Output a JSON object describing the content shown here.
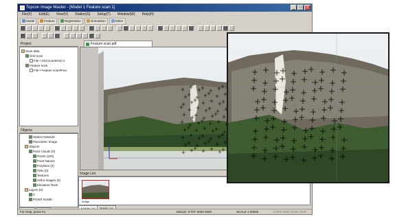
{
  "window": {
    "title": "Topcon Image Master - [Model 1 Feature scan 1]"
  },
  "menu": [
    "File(F)",
    "Edit(E)",
    "View(V)",
    "Station(S)",
    "Setup(T)",
    "Window(W)",
    "Help(H)"
  ],
  "workspaces": [
    {
      "label": "Model",
      "color": "#6a8fc9"
    },
    {
      "label": "Feature",
      "color": "#d08a2a"
    },
    {
      "label": "Registration",
      "color": "#4a9a4a"
    },
    {
      "label": "Orientation",
      "color": "#c9a040"
    },
    {
      "label": "Editor",
      "color": "#7aa3d8"
    }
  ],
  "project_panel": {
    "header": "Project",
    "tree": [
      {
        "label": "Scan data",
        "indent": 0,
        "color": "#e0c060"
      },
      {
        "label": "Grid scan",
        "indent": 1,
        "color": "#5a9a5a"
      },
      {
        "label": "File • Grid scan#Grid s",
        "indent": 2,
        "color": "#ffffff"
      },
      {
        "label": "Feature scan",
        "indent": 1,
        "color": "#5a9a5a"
      },
      {
        "label": "File • Feature scan#Fea",
        "indent": 2,
        "color": "#ffffff"
      }
    ]
  },
  "objects_panel": {
    "header": "Objects",
    "tree": [
      {
        "label": "Station Network",
        "indent": 2,
        "color": "#5a9a5a"
      },
      {
        "label": "Panoramic Image",
        "indent": 2,
        "color": "#5a9a5a"
      },
      {
        "label": "Objects",
        "indent": 1,
        "color": "#e0c060"
      },
      {
        "label": "Point Clouds (0)",
        "indent": 2,
        "color": "#4a9a4a"
      },
      {
        "label": "Points (100)",
        "indent": 3,
        "color": "#4a9a4a"
      },
      {
        "label": "Point Names",
        "indent": 3,
        "color": "#4a9a4a"
      },
      {
        "label": "Polylines (0)",
        "indent": 3,
        "color": "#4a9a4a"
      },
      {
        "label": "TINs (0)",
        "indent": 3,
        "color": "#4a9a4a"
      },
      {
        "label": "Textures",
        "indent": 3,
        "color": "#4a9a4a"
      },
      {
        "label": "Ortho-images (0)",
        "indent": 3,
        "color": "#4a9a4a"
      },
      {
        "label": "Elevation Texts",
        "indent": 3,
        "color": "#4a9a4a"
      },
      {
        "label": "Layers (0)",
        "indent": 1,
        "color": "#e0c060"
      },
      {
        "label": "0",
        "indent": 2,
        "color": "#4a9a4a"
      },
      {
        "label": "POINT NAME",
        "indent": 2,
        "color": "#4a9a4a"
      }
    ]
  },
  "panel_tabs": [
    "Objects",
    "Details"
  ],
  "doc_tab": "Feature scan.pdf",
  "image_list": {
    "header": "Image List",
    "tabs": [
      "Image List",
      "Detail List"
    ],
    "thumb_label": "Image"
  },
  "status": {
    "help": "For Help, press F1",
    "info": "ANGLE: 0°0'0\" 0000 0000",
    "scale": "SCALE 1:00000",
    "indicators": "CAPS  NUM  SCRL  OVR"
  },
  "colors": {
    "titlebar": "#0a246a",
    "thumb_border": "#d02020",
    "zoom_border": "#1a1a1a"
  }
}
